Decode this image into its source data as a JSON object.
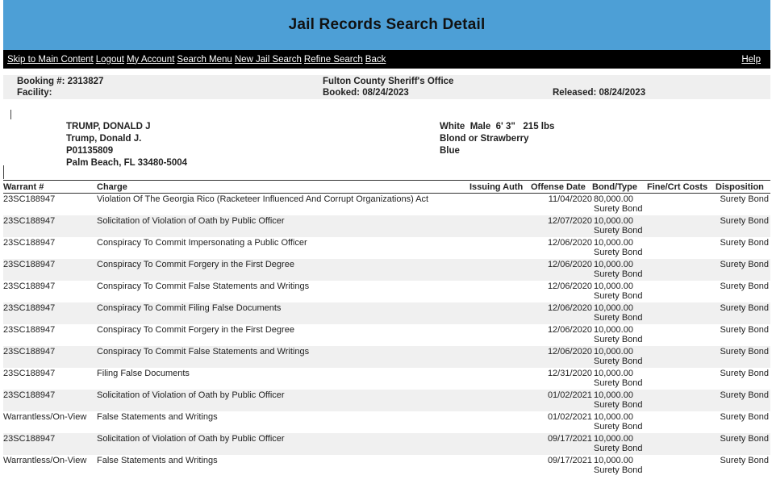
{
  "header": {
    "title": "Jail Records Search Detail"
  },
  "nav": {
    "links": [
      "Skip to Main Content",
      "Logout",
      "My Account",
      "Search Menu",
      "New Jail Search",
      "Refine Search",
      "Back"
    ],
    "help": "Help"
  },
  "booking": {
    "booking_number": "Booking #: 2313827",
    "facility": "Facility:",
    "agency": "Fulton County Sheriff's Office",
    "booked": "Booked: 08/24/2023",
    "released": "Released: 08/24/2023"
  },
  "person": {
    "name_upper": "TRUMP, DONALD J",
    "name": "Trump, Donald J.",
    "id": "P01135809",
    "city": "Palm Beach, FL 33480-5004",
    "race_sex_height_weight": "White  Male  6' 3\"   215 lbs",
    "hair": "Blond or Strawberry",
    "eyes": "Blue"
  },
  "table": {
    "columns": [
      "Warrant #",
      "Charge",
      "Issuing Auth",
      "Offense Date",
      "Bond/Type",
      "Fine/Crt Costs",
      "Disposition"
    ],
    "rows": [
      {
        "warrant": "23SC188947",
        "charge": "Violation Of The Georgia Rico (Racketeer Influenced And Corrupt Organizations) Act",
        "date": "11/04/2020",
        "bond": "80,000.00",
        "bond_type": "Surety Bond",
        "disposition": "Surety Bond"
      },
      {
        "warrant": "23SC188947",
        "charge": "Solicitation of Violation of Oath by Public Officer",
        "date": "12/07/2020",
        "bond": "10,000.00",
        "bond_type": "Surety Bond",
        "disposition": "Surety Bond"
      },
      {
        "warrant": "23SC188947",
        "charge": "Conspiracy To Commit Impersonating a Public Officer",
        "date": "12/06/2020",
        "bond": "10,000.00",
        "bond_type": "Surety Bond",
        "disposition": "Surety Bond"
      },
      {
        "warrant": "23SC188947",
        "charge": "Conspiracy To Commit Forgery in the First Degree",
        "date": "12/06/2020",
        "bond": "10,000.00",
        "bond_type": "Surety Bond",
        "disposition": "Surety Bond"
      },
      {
        "warrant": "23SC188947",
        "charge": "Conspiracy To Commit False Statements and Writings",
        "date": "12/06/2020",
        "bond": "10,000.00",
        "bond_type": "Surety Bond",
        "disposition": "Surety Bond"
      },
      {
        "warrant": "23SC188947",
        "charge": "Conspiracy To Commit Filing False Documents",
        "date": "12/06/2020",
        "bond": "10,000.00",
        "bond_type": "Surety Bond",
        "disposition": "Surety Bond"
      },
      {
        "warrant": "23SC188947",
        "charge": "Conspiracy To Commit Forgery in the First Degree",
        "date": "12/06/2020",
        "bond": "10,000.00",
        "bond_type": "Surety Bond",
        "disposition": "Surety Bond"
      },
      {
        "warrant": "23SC188947",
        "charge": "Conspiracy To Commit False Statements and Writings",
        "date": "12/06/2020",
        "bond": "10,000.00",
        "bond_type": "Surety Bond",
        "disposition": "Surety Bond"
      },
      {
        "warrant": "23SC188947",
        "charge": "Filing False Documents",
        "date": "12/31/2020",
        "bond": "10,000.00",
        "bond_type": "Surety Bond",
        "disposition": "Surety Bond"
      },
      {
        "warrant": "23SC188947",
        "charge": "Solicitation of Violation of Oath by Public Officer",
        "date": "01/02/2021",
        "bond": "10,000.00",
        "bond_type": "Surety Bond",
        "disposition": "Surety Bond"
      },
      {
        "warrant": "Warrantless/On-View",
        "charge": "False Statements and Writings",
        "date": "01/02/2021",
        "bond": "10,000.00",
        "bond_type": "Surety Bond",
        "disposition": "Surety Bond"
      },
      {
        "warrant": "23SC188947",
        "charge": "Solicitation of Violation of Oath by Public Officer",
        "date": "09/17/2021",
        "bond": "10,000.00",
        "bond_type": "Surety Bond",
        "disposition": "Surety Bond"
      },
      {
        "warrant": "Warrantless/On-View",
        "charge": "False Statements and Writings",
        "date": "09/17/2021",
        "bond": "10,000.00",
        "bond_type": "Surety Bond",
        "disposition": "Surety Bond"
      }
    ]
  }
}
